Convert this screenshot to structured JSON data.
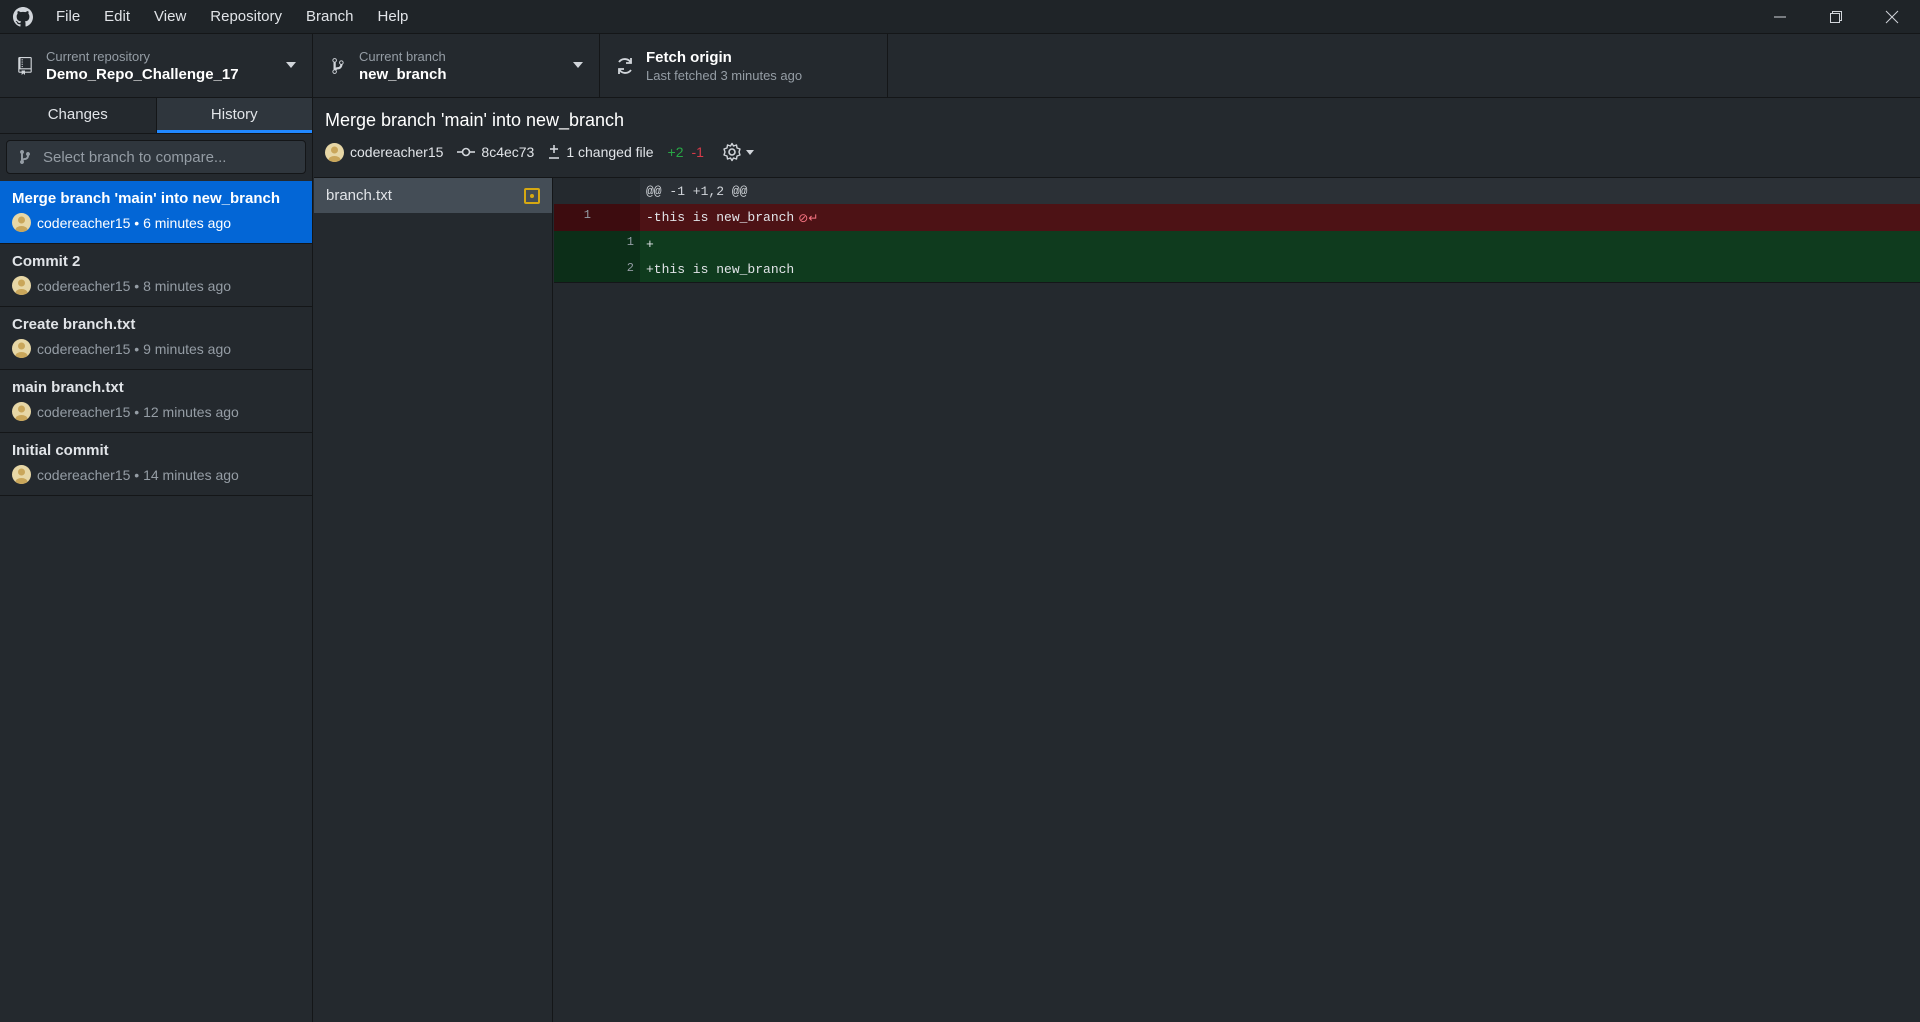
{
  "menu": {
    "items": [
      "File",
      "Edit",
      "View",
      "Repository",
      "Branch",
      "Help"
    ]
  },
  "toolbar": {
    "repo_label": "Current repository",
    "repo_value": "Demo_Repo_Challenge_17",
    "branch_label": "Current branch",
    "branch_value": "new_branch",
    "fetch_label": "Fetch origin",
    "fetch_sub": "Last fetched 3 minutes ago"
  },
  "sidebar": {
    "tabs": [
      "Changes",
      "History"
    ],
    "active_tab": "History",
    "compare_placeholder": "Select branch to compare...",
    "commits": [
      {
        "title": "Merge branch 'main' into new_branch",
        "meta": "codereacher15 • 6 minutes ago"
      },
      {
        "title": "Commit 2",
        "meta": "codereacher15 • 8 minutes ago"
      },
      {
        "title": "Create branch.txt",
        "meta": "codereacher15 • 9 minutes ago"
      },
      {
        "title": "main branch.txt",
        "meta": "codereacher15 • 12 minutes ago"
      },
      {
        "title": "Initial commit",
        "meta": "codereacher15 • 14 minutes ago"
      }
    ]
  },
  "commit": {
    "title": "Merge branch 'main' into new_branch",
    "author": "codereacher15",
    "sha": "8c4ec73",
    "changed": "1 changed file",
    "added": "+2",
    "removed": "-1"
  },
  "files": [
    {
      "name": "branch.txt",
      "status": "modified"
    }
  ],
  "diff": {
    "hunk": "@@ -1 +1,2 @@",
    "lines": [
      {
        "type": "del",
        "old": "1",
        "new": "",
        "text": "-this is new_branch"
      },
      {
        "type": "add",
        "old": "",
        "new": "1",
        "text": "+"
      },
      {
        "type": "add",
        "old": "",
        "new": "2",
        "text": "+this is new_branch"
      }
    ]
  },
  "colors": {
    "accent": "#0366d6",
    "added": "#28a745",
    "removed": "#d73a49",
    "modified": "#d6a812"
  },
  "icons": {
    "logo": "github-icon",
    "repo": "repo-icon",
    "branch": "git-branch-icon",
    "fetch": "sync-icon",
    "commit": "git-commit-icon",
    "diff": "diff-icon",
    "settings": "gear-icon"
  }
}
